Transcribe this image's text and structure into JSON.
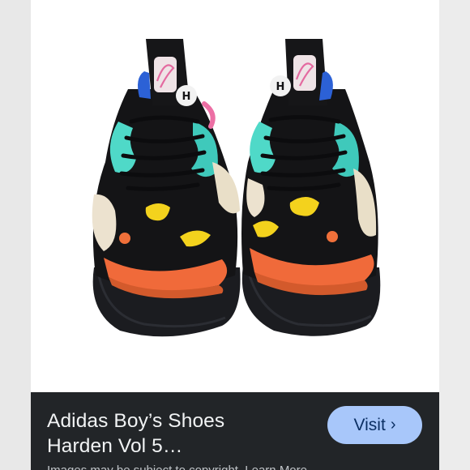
{
  "product": {
    "title_line1": "Adidas Boy’s Shoes",
    "title_line2": "Harden Vol 5…"
  },
  "actions": {
    "visit_label": "Visit",
    "visit_icon": "chevron-right-icon"
  },
  "cut_off_text": "Images may be subject to copyright.  Learn More",
  "colors": {
    "card_background": "#222528",
    "visit_button": "#a8c7fa",
    "visit_text": "#0b2f63"
  }
}
